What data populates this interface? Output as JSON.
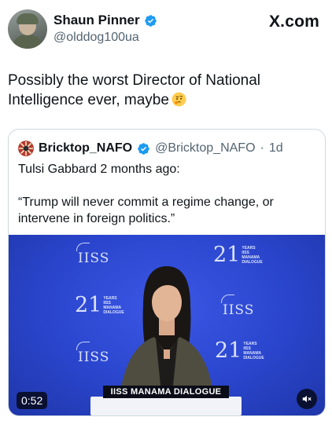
{
  "author": {
    "display_name": "Shaun Pinner",
    "handle": "@olddog100ua",
    "verified": true
  },
  "site_label": "X.com",
  "tweet": {
    "text": "Possibly the worst Director of National Intelligence ever, maybe",
    "emoji": "thinking-face-icon"
  },
  "quoted_tweet": {
    "display_name": "Bricktop_NAFO",
    "handle": "@Bricktop_NAFO",
    "separator": "·",
    "time": "1d",
    "line1": "Tulsi Gabbard 2 months ago:",
    "line2": "“Trump will never commit a regime change, or intervene in foreign politics.”"
  },
  "video": {
    "duration": "0:52",
    "podium_label": "IISS MANAMA DIALOGUE",
    "logo_text": "IISS",
    "badge_number": "21",
    "badge_lines": [
      "YEARS",
      "IISS",
      "Manama",
      "Dialogue"
    ]
  },
  "colors": {
    "verified_blue": "#1d9bf0",
    "stage_blue": "#2a45cc",
    "secondary_text": "#536471"
  }
}
